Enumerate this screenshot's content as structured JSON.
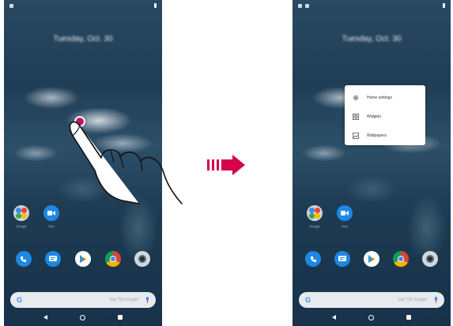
{
  "before": {
    "date": "Tuesday, Oct. 30",
    "apps_row1": [
      {
        "name": "folder",
        "label": "Google"
      },
      {
        "name": "duo",
        "label": "Duo"
      }
    ],
    "search_hint": "Say \"Ok Google\""
  },
  "after": {
    "date": "Tuesday, Oct. 30",
    "apps_row1": [
      {
        "name": "folder",
        "label": "Google"
      },
      {
        "name": "duo",
        "label": "Duo"
      }
    ],
    "menu": {
      "items": [
        {
          "label": "Home settings",
          "icon": "gear-icon"
        },
        {
          "label": "Widgets",
          "icon": "widgets-icon"
        },
        {
          "label": "Wallpapers",
          "icon": "wallpaper-icon"
        }
      ]
    },
    "search_hint": "Say \"Ok Google\""
  },
  "colors": {
    "tap_dot": "#c2185b",
    "arrow": "#d6004b"
  }
}
